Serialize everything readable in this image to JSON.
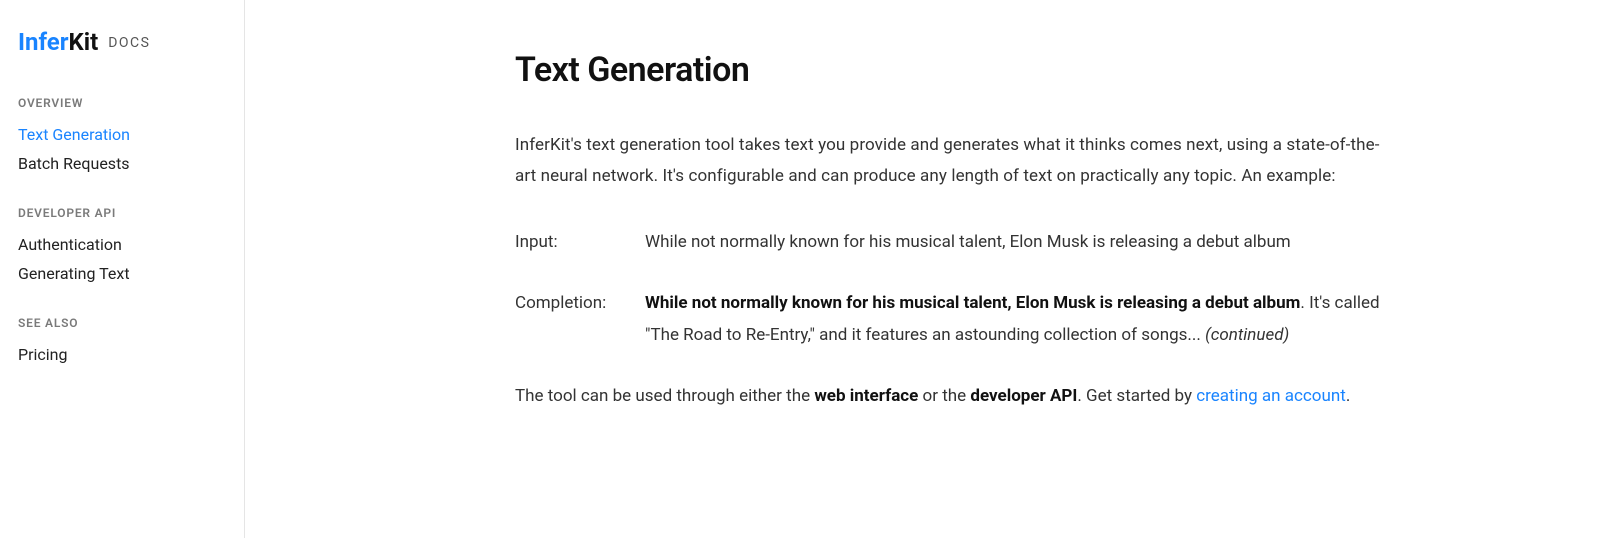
{
  "logo": {
    "part1": "Infer",
    "part2": "Kit",
    "docs": "DOCS"
  },
  "sidebar": {
    "sections": [
      {
        "heading": "OVERVIEW",
        "items": [
          {
            "label": "Text Generation",
            "active": true
          },
          {
            "label": "Batch Requests",
            "active": false
          }
        ]
      },
      {
        "heading": "DEVELOPER API",
        "items": [
          {
            "label": "Authentication",
            "active": false
          },
          {
            "label": "Generating Text",
            "active": false
          }
        ]
      },
      {
        "heading": "SEE ALSO",
        "items": [
          {
            "label": "Pricing",
            "active": false
          }
        ]
      }
    ]
  },
  "page": {
    "title": "Text Generation",
    "intro": "InferKit's text generation tool takes text you provide and generates what it thinks comes next, using a state-of-the-art neural network. It's configurable and can produce any length of text on practically any topic. An example:",
    "example": {
      "input_label": "Input:",
      "input_text": "While not normally known for his musical talent, Elon Musk is releasing a debut album",
      "completion_label": "Completion:",
      "completion_bold": "While not normally known for his musical talent, Elon Musk is releasing a debut album",
      "completion_rest": ". It's called \"The Road to Re-Entry,\" and it features an astounding collection of songs... ",
      "completion_continued": "(continued)"
    },
    "footer": {
      "seg1": "The tool can be used through either the ",
      "web_interface": "web interface",
      "seg2": " or the ",
      "developer_api": "developer API",
      "seg3": ". Get started by ",
      "creating_account": "creating an account",
      "seg4": "."
    }
  }
}
